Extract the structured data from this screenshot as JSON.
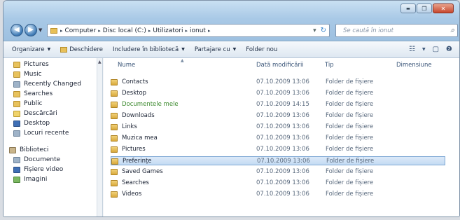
{
  "window": {
    "caption": {
      "minimize": "▬",
      "maximize": "❐",
      "close": "✕"
    }
  },
  "nav": {
    "back": "◀",
    "forward": "▶",
    "dropdown": "▼"
  },
  "address": {
    "crumbs": [
      "Computer",
      "Disc local (C:)",
      "Utilizatori",
      "ionut"
    ],
    "separator": "▸",
    "dropdown": "▾",
    "refresh": "↻"
  },
  "search": {
    "placeholder": "Se caută în ionut",
    "icon": "⌕"
  },
  "toolbar": {
    "organize": "Organizare",
    "open": "Deschidere",
    "include_library": "Includere în bibliotecă",
    "share": "Partajare cu",
    "new_folder": "Folder nou",
    "arrow": "▼",
    "view_icon": "☷",
    "preview_icon": "▢",
    "help_icon": "❷"
  },
  "sidebar": {
    "items": [
      {
        "label": "Pictures",
        "icon": "pictures-icon"
      },
      {
        "label": "Music",
        "icon": "music-icon"
      },
      {
        "label": "Recently Changed",
        "icon": "recent-icon"
      },
      {
        "label": "Searches",
        "icon": "searches-icon"
      },
      {
        "label": "Public",
        "icon": "folder-icon"
      },
      {
        "label": "Descărcări",
        "icon": "downloads-icon"
      },
      {
        "label": "Desktop",
        "icon": "desktop-icon"
      },
      {
        "label": "Locuri recente",
        "icon": "recent-places-icon"
      },
      {
        "label": "Biblioteci",
        "icon": "libraries-icon"
      },
      {
        "label": "Documente",
        "icon": "documents-icon"
      },
      {
        "label": "Fișiere video",
        "icon": "videos-icon"
      },
      {
        "label": "Imagini",
        "icon": "pictures-icon"
      }
    ],
    "scroll_up": "▲"
  },
  "columns": {
    "name": "Nume",
    "date": "Dată modificării",
    "type": "Tip",
    "size": "Dimensiune",
    "sort_mark": "▲"
  },
  "files": [
    {
      "name": "Contacts",
      "date": "07.10.2009 13:06",
      "type": "Folder de fișiere"
    },
    {
      "name": "Desktop",
      "date": "07.10.2009 13:06",
      "type": "Folder de fișiere"
    },
    {
      "name": "Documentele mele",
      "date": "07.10.2009 14:15",
      "type": "Folder de fișiere"
    },
    {
      "name": "Downloads",
      "date": "07.10.2009 13:06",
      "type": "Folder de fișiere"
    },
    {
      "name": "Links",
      "date": "07.10.2009 13:06",
      "type": "Folder de fișiere"
    },
    {
      "name": "Muzica mea",
      "date": "07.10.2009 13:06",
      "type": "Folder de fișiere"
    },
    {
      "name": "Pictures",
      "date": "07.10.2009 13:06",
      "type": "Folder de fișiere"
    },
    {
      "name": "Preferințe",
      "date": "07.10.2009 13:06",
      "type": "Folder de fișiere"
    },
    {
      "name": "Saved Games",
      "date": "07.10.2009 13:06",
      "type": "Folder de fișiere"
    },
    {
      "name": "Searches",
      "date": "07.10.2009 13:06",
      "type": "Folder de fișiere"
    },
    {
      "name": "Videos",
      "date": "07.10.2009 13:06",
      "type": "Folder de fișiere"
    }
  ],
  "selected_file": "Preferințe",
  "colors": {
    "accent": "#3f6fb5",
    "selection": "#c4dbf3",
    "highlight_text": "#3c8a2e"
  }
}
